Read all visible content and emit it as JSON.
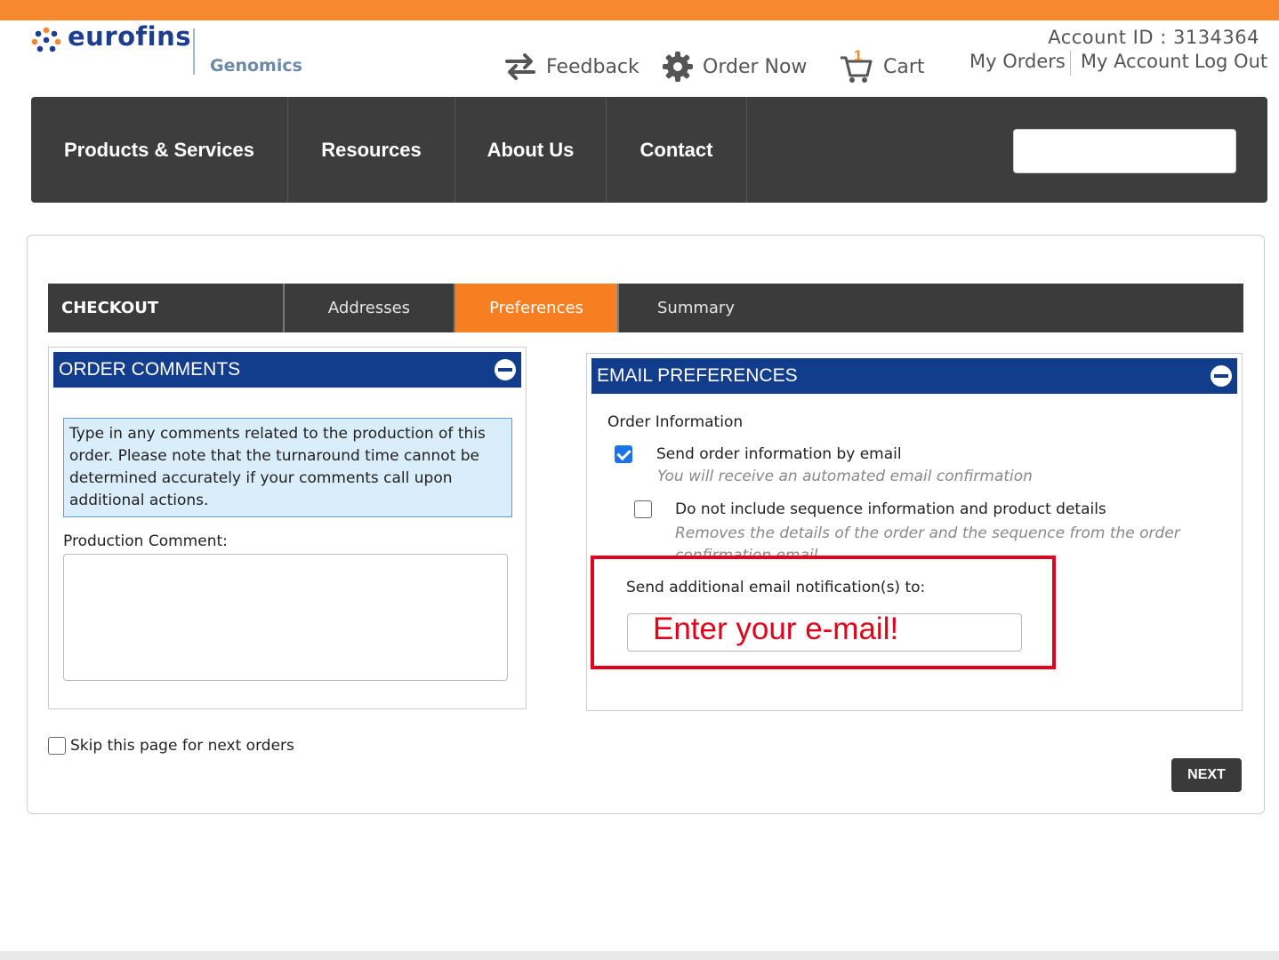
{
  "brand": {
    "name": "eurofins",
    "sub": "Genomics",
    "accent": "#f7882f",
    "navy": "#123c8c"
  },
  "header": {
    "feedback": "Feedback",
    "order_now": "Order Now",
    "cart": "Cart",
    "cart_count": "1",
    "account_id": "Account ID : 3134364",
    "my_orders": "My Orders",
    "my_account": "My Account",
    "log_out": "Log Out"
  },
  "nav": {
    "items": [
      "Products & Services",
      "Resources",
      "About Us",
      "Contact"
    ],
    "search_placeholder": ""
  },
  "steps": {
    "checkout": "CHECKOUT",
    "addresses": "Addresses",
    "preferences": "Preferences",
    "summary": "Summary",
    "active": "Preferences"
  },
  "order_comments": {
    "title": "ORDER COMMENTS",
    "note": "Type in any comments related to the production of this order. Please note that the turnaround time cannot be determined accurately if your comments call upon additional actions.",
    "label": "Production Comment:",
    "value": ""
  },
  "email_preferences": {
    "title": "EMAIL PREFERENCES",
    "section": "Order Information",
    "opt1_label": "Send order information by email",
    "opt1_checked": true,
    "opt1_hint": "You will receive an automated email confirmation",
    "opt2_label": "Do not include sequence information and product details",
    "opt2_checked": false,
    "opt2_hint": "Removes the details of the order and the sequence from the order confirmation email",
    "additional_label": "Send additional email notification(s) to:",
    "additional_placeholder": "Enter your e-mail!"
  },
  "footer": {
    "skip_label": "Skip this page for next orders",
    "skip_checked": false,
    "next": "NEXT"
  }
}
